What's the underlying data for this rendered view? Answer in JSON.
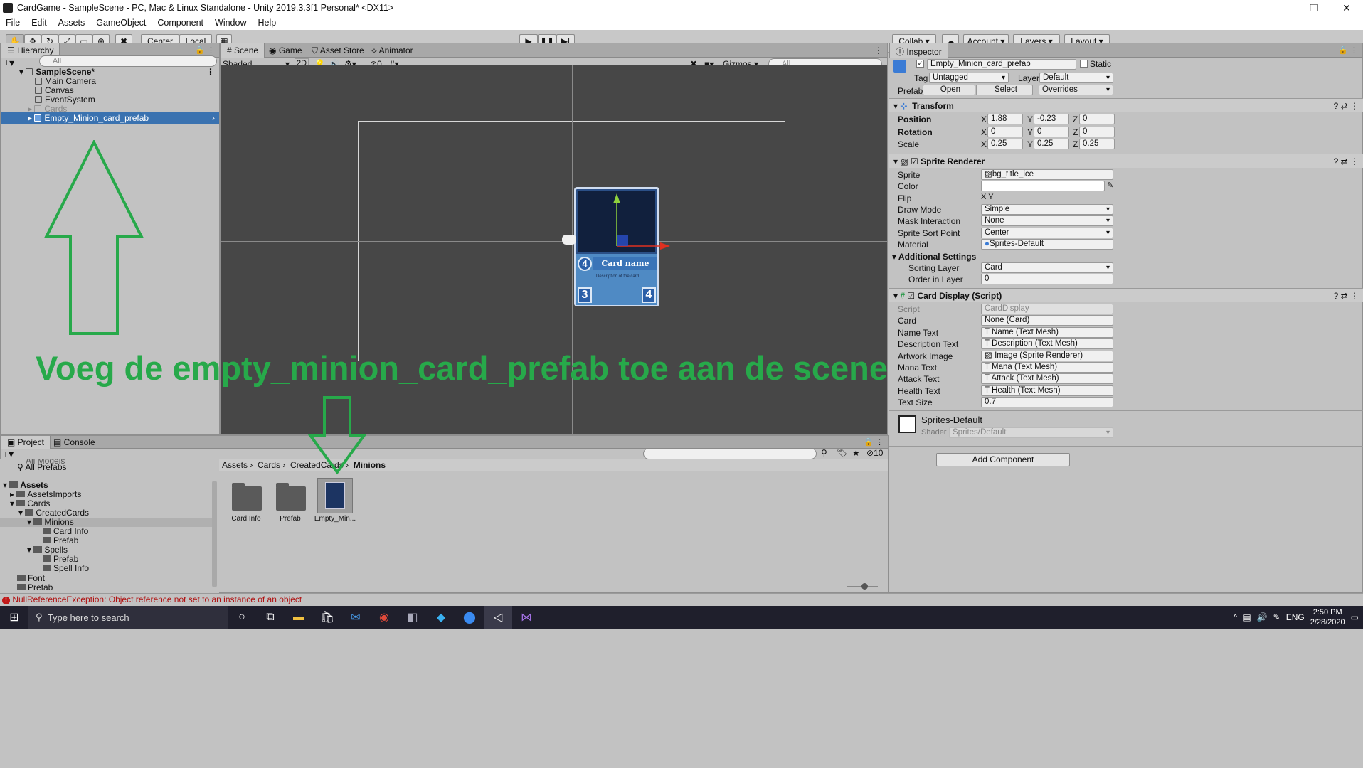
{
  "window": {
    "title": "CardGame - SampleScene - PC, Mac & Linux Standalone - Unity 2019.3.3f1 Personal* <DX11>"
  },
  "menu": [
    "File",
    "Edit",
    "Assets",
    "GameObject",
    "Component",
    "Window",
    "Help"
  ],
  "toolbar": {
    "center": "Center",
    "local": "Local",
    "collab": "Collab ▾",
    "account": "Account",
    "layers": "Layers",
    "layout": "Layout"
  },
  "hierarchy": {
    "title": "Hierarchy",
    "search": "All",
    "scene": "SampleScene*",
    "items": [
      "Main Camera",
      "Canvas",
      "EventSystem",
      "Cards",
      "Empty_Minion_card_prefab"
    ]
  },
  "sceneview": {
    "tabs": [
      "Scene",
      "Game",
      "Asset Store",
      "Animator"
    ],
    "shading": "Shaded",
    "mode2d": "2D",
    "hidden": "0",
    "gizmos": "Gizmos",
    "search": "All"
  },
  "card": {
    "mana": "4",
    "name": "Card name",
    "desc": "Description of the card",
    "attack": "3",
    "health": "4"
  },
  "annotation": {
    "text": "Voeg de empty_minion_card_prefab toe aan de scene",
    "color": "#27a94a"
  },
  "inspector": {
    "title": "Inspector",
    "object": "Empty_Minion_card_prefab",
    "static": "Static",
    "tag_label": "Tag",
    "tag": "Untagged",
    "layer_label": "Layer",
    "layer": "Default",
    "prefab_label": "Prefab",
    "open": "Open",
    "select": "Select",
    "overrides": "Overrides",
    "transform": {
      "title": "Transform",
      "position": {
        "label": "Position",
        "x": "1.88",
        "y": "-0.23",
        "z": "0"
      },
      "rotation": {
        "label": "Rotation",
        "x": "0",
        "y": "0",
        "z": "0"
      },
      "scale": {
        "label": "Scale",
        "x": "0.25",
        "y": "0.25",
        "z": "0.25"
      }
    },
    "sprite_renderer": {
      "title": "Sprite Renderer",
      "rows": [
        {
          "label": "Sprite",
          "value": "bg_title_ice"
        },
        {
          "label": "Color",
          "value": ""
        },
        {
          "label": "Flip",
          "value": "X   Y"
        },
        {
          "label": "Draw Mode",
          "value": "Simple"
        },
        {
          "label": "Mask Interaction",
          "value": "None"
        },
        {
          "label": "Sprite Sort Point",
          "value": "Center"
        },
        {
          "label": "Material",
          "value": "Sprites-Default"
        }
      ],
      "additional": "Additional Settings",
      "sorting_layer": {
        "label": "Sorting Layer",
        "value": "Card"
      },
      "order": {
        "label": "Order in Layer",
        "value": "0"
      }
    },
    "card_display": {
      "title": "Card Display (Script)",
      "rows": [
        {
          "label": "Script",
          "value": "CardDisplay"
        },
        {
          "label": "Card",
          "value": "None (Card)"
        },
        {
          "label": "Name Text",
          "value": "Name (Text Mesh)"
        },
        {
          "label": "Description Text",
          "value": "Description (Text Mesh)"
        },
        {
          "label": "Artwork Image",
          "value": "Image (Sprite Renderer)"
        },
        {
          "label": "Mana Text",
          "value": "Mana (Text Mesh)"
        },
        {
          "label": "Attack Text",
          "value": "Attack (Text Mesh)"
        },
        {
          "label": "Health Text",
          "value": "Health (Text Mesh)"
        },
        {
          "label": "Text Size",
          "value": "0.7"
        }
      ]
    },
    "material": {
      "name": "Sprites-Default",
      "shader_label": "Shader",
      "shader": "Sprites/Default"
    },
    "add_component": "Add Component"
  },
  "project": {
    "tabs": [
      "Project",
      "Console"
    ],
    "hidden_count": "10",
    "tree": [
      {
        "label": "All Models",
        "depth": 1
      },
      {
        "label": "All Prefabs",
        "depth": 1
      },
      {
        "label": "Assets",
        "depth": 0
      },
      {
        "label": "AssetsImports",
        "depth": 1
      },
      {
        "label": "Cards",
        "depth": 1
      },
      {
        "label": "CreatedCards",
        "depth": 2
      },
      {
        "label": "Minions",
        "depth": 3
      },
      {
        "label": "Card Info",
        "depth": 4
      },
      {
        "label": "Prefab",
        "depth": 4
      },
      {
        "label": "Spells",
        "depth": 3
      },
      {
        "label": "Prefab",
        "depth": 4
      },
      {
        "label": "Spell Info",
        "depth": 4
      },
      {
        "label": "Font",
        "depth": 1
      },
      {
        "label": "Prefab",
        "depth": 1
      }
    ],
    "breadcrumb": [
      "Assets",
      "Cards",
      "CreatedCards",
      "Minions"
    ],
    "assets": [
      "Card Info",
      "Prefab",
      "Empty_Min..."
    ]
  },
  "console_error": "NullReferenceException: Object reference not set to an instance of an object",
  "taskbar": {
    "search": "Type here to search",
    "lang": "ENG",
    "time": "2:50 PM",
    "date": "2/28/2020"
  }
}
